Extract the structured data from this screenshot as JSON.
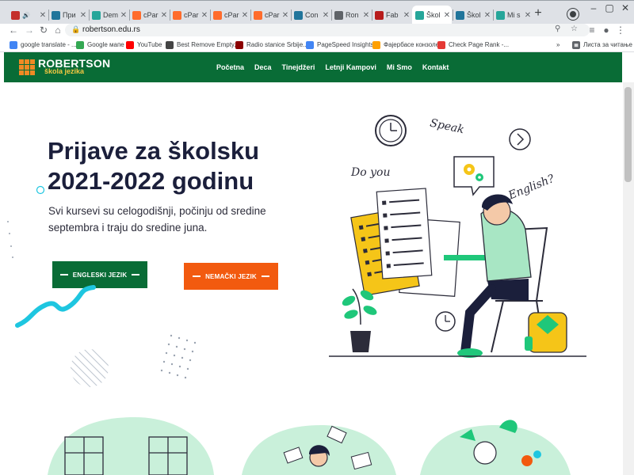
{
  "browser": {
    "tabs": [
      {
        "title": "",
        "favicon": "youtube-red-icon",
        "color": "#c4302b",
        "audio": true
      },
      {
        "title": "При",
        "favicon": "wordpress-icon",
        "color": "#21759b"
      },
      {
        "title": "Dem",
        "favicon": "shield-icon",
        "color": "#26a69a"
      },
      {
        "title": "cPar",
        "favicon": "cpanel-icon",
        "color": "#ff6c2c"
      },
      {
        "title": "cPar",
        "favicon": "cpanel-icon",
        "color": "#ff6c2c"
      },
      {
        "title": "cPar",
        "favicon": "cpanel-icon",
        "color": "#ff6c2c"
      },
      {
        "title": "cPar",
        "favicon": "cpanel-icon",
        "color": "#ff6c2c"
      },
      {
        "title": "Con",
        "favicon": "wordpress-icon",
        "color": "#21759b"
      },
      {
        "title": "Ron",
        "favicon": "link-icon",
        "color": "#5f6368"
      },
      {
        "title": "Fab",
        "favicon": "fab-icon",
        "color": "#b71c1c"
      },
      {
        "title": "Škol",
        "favicon": "shield-icon",
        "color": "#26a69a",
        "active": true
      },
      {
        "title": "Škol",
        "favicon": "wordpress-icon",
        "color": "#21759b"
      },
      {
        "title": "Mi s",
        "favicon": "shield-icon",
        "color": "#26a69a"
      }
    ],
    "new_tab": "+",
    "url": "robertson.edu.rs",
    "bookmarks": [
      {
        "label": "google translate - ...",
        "icon": "google-icon",
        "color": "#4285f4"
      },
      {
        "label": "Google мапе",
        "icon": "maps-pin-icon",
        "color": "#34a853"
      },
      {
        "label": "YouTube",
        "icon": "youtube-icon",
        "color": "#ff0000"
      },
      {
        "label": "Best Remove Empty...",
        "icon": "cb-icon",
        "color": "#444444"
      },
      {
        "label": "Radio stanice Srbije...",
        "icon": "radio-icon",
        "color": "#8b0000"
      },
      {
        "label": "PageSpeed Insights",
        "icon": "pagespeed-icon",
        "color": "#4285f4"
      },
      {
        "label": "Фајербасе конзоле",
        "icon": "firebase-icon",
        "color": "#ffa000"
      },
      {
        "label": "Check Page Rank -...",
        "icon": "pagerank-icon",
        "color": "#e53935"
      }
    ],
    "reading_list": "Листа за читање"
  },
  "site": {
    "logo_title": "ROBERTSON",
    "logo_sub": "škola jezika",
    "nav": [
      "Početna",
      "Deca",
      "Tinejdžeri",
      "Letnji Kampovi",
      "Mi Smo",
      "Kontakt"
    ],
    "hero_title_line1": "Prijave za školsku",
    "hero_title_line2": "2021-2022 godinu",
    "hero_sub": "Svi kursevi su celogodišnji, počinju od sredine septembra i traju do sredine juna.",
    "btn_english": "ENGLESKI JEZIK",
    "btn_german": "NEMAČKI JEZIK",
    "illustration_words": {
      "speak": "Speak",
      "do_you": "Do you",
      "english": "English?"
    }
  },
  "colors": {
    "brand_green": "#096c36",
    "accent_orange": "#f25a0f",
    "logo_orange": "#f08a24",
    "illustration_green": "#1fc77a",
    "illustration_yellow": "#f5c518",
    "wave_cyan": "#1ec6e0"
  }
}
